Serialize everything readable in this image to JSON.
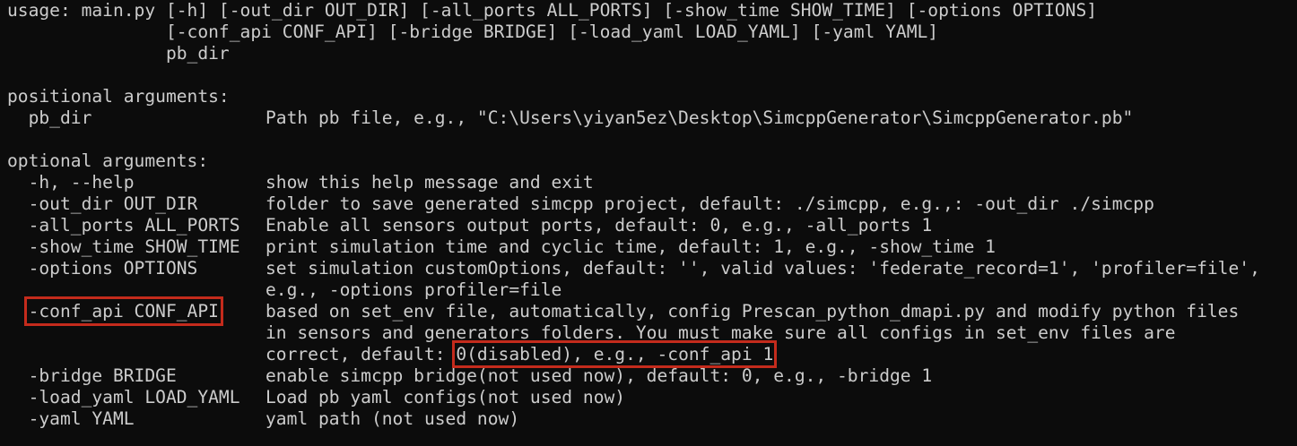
{
  "usage": {
    "line1": "usage: main.py [-h] [-out_dir OUT_DIR] [-all_ports ALL_PORTS] [-show_time SHOW_TIME] [-options OPTIONS]",
    "line2": "               [-conf_api CONF_API] [-bridge BRIDGE] [-load_yaml LOAD_YAML] [-yaml YAML]",
    "line3": "               pb_dir"
  },
  "positional": {
    "heading": "positional arguments:",
    "args": [
      {
        "name": "  pb_dir",
        "help": "Path pb file, e.g., \"C:\\Users\\yiyan5ez\\Desktop\\SimcppGenerator\\SimcppGenerator.pb\""
      }
    ]
  },
  "optional": {
    "heading": "optional arguments:",
    "args": [
      {
        "name": "  -h, --help",
        "help": "show this help message and exit"
      },
      {
        "name": "  -out_dir OUT_DIR",
        "help": "folder to save generated simcpp project, default: ./simcpp, e.g.,: -out_dir ./simcpp"
      },
      {
        "name": "  -all_ports ALL_PORTS",
        "help": "Enable all sensors output ports, default: 0, e.g., -all_ports 1"
      },
      {
        "name": "  -show_time SHOW_TIME",
        "help": "print simulation time and cyclic time, default: 1, e.g., -show_time 1"
      },
      {
        "name": "  -options OPTIONS",
        "help": "set simulation customOptions, default: '', valid values: 'federate_record=1', 'profiler=file',",
        "help2": "e.g., -options profiler=file"
      },
      {
        "name": "-conf_api CONF_API",
        "help": "based on set_env file, automatically, config Prescan_python_dmapi.py and modify python files",
        "help2": "in sensors and generators folders. You must make sure all configs in set_env files are",
        "help3_prefix": "correct, default: ",
        "help3_highlight": "0(disabled), e.g., -conf_api 1"
      },
      {
        "name": "  -bridge BRIDGE",
        "help": "enable simcpp bridge(not used now), default: 0, e.g., -bridge 1"
      },
      {
        "name": "  -load_yaml LOAD_YAML",
        "help": "Load pb yaml configs(not used now)"
      },
      {
        "name": "  -yaml YAML",
        "help": "yaml path (not used now)"
      }
    ]
  },
  "colors": {
    "background": "#0c0c0c",
    "text": "#cccccc",
    "highlight_box": "#c42b1c"
  }
}
